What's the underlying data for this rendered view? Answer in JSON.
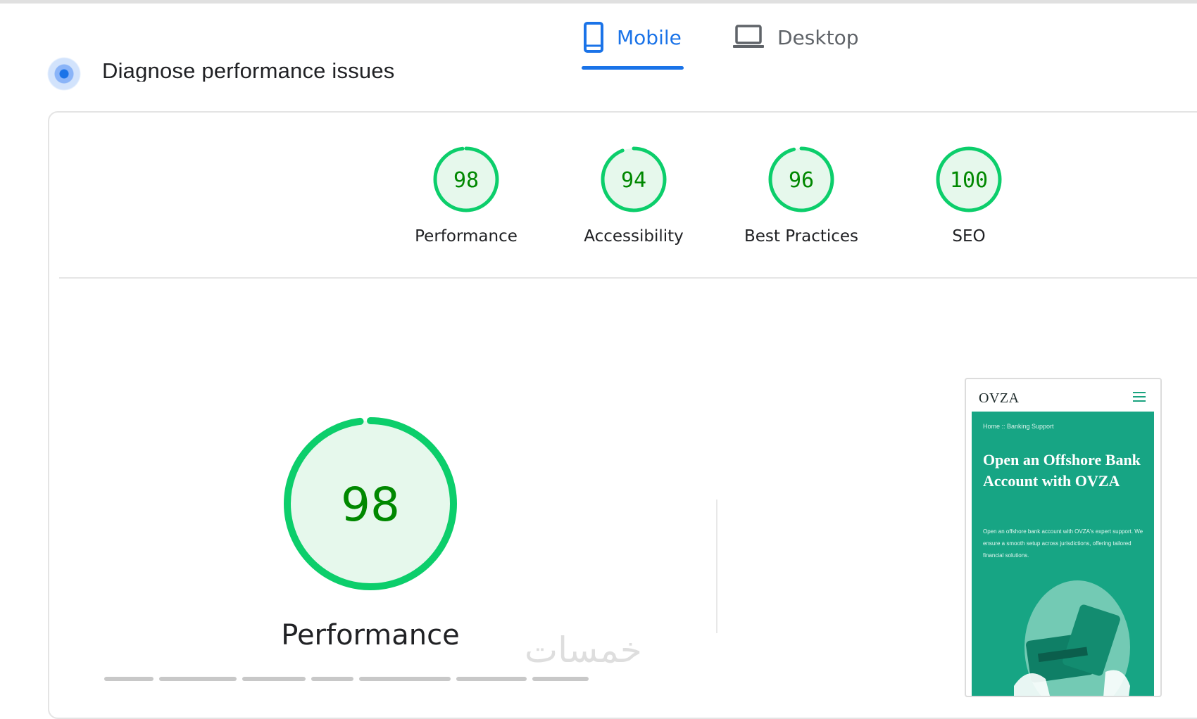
{
  "tabs": [
    {
      "label": "Mobile",
      "icon": "smartphone-icon",
      "active": true
    },
    {
      "label": "Desktop",
      "icon": "laptop-icon",
      "active": false
    }
  ],
  "section": {
    "title": "Diagnose performance issues"
  },
  "scores": [
    {
      "value": "98",
      "label": "Performance",
      "score": 98
    },
    {
      "value": "94",
      "label": "Accessibility",
      "score": 94
    },
    {
      "value": "96",
      "label": "Best Practices",
      "score": 96
    },
    {
      "value": "100",
      "label": "SEO",
      "score": 100
    }
  ],
  "main_score": {
    "value": "98",
    "label": "Performance",
    "score": 98
  },
  "preview": {
    "logo": "OVZA",
    "breadcrumb": "Home  ::  Banking Support",
    "headline": "Open an Offshore Bank Account with OVZA",
    "body": "Open an offshore bank account with OVZA's expert support. We ensure a smooth setup across jurisdictions, offering tailored financial solutions."
  },
  "watermark": "خمسات",
  "colors": {
    "accent": "#1a73e8",
    "pass": "#0cce6b",
    "pass_text": "#008800",
    "pass_fill": "#e6f8ec",
    "brand": "#17a584"
  }
}
